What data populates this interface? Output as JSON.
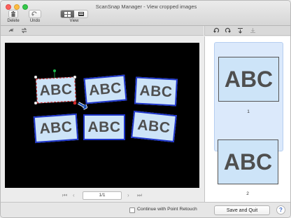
{
  "window": {
    "title": "ScanSnap Manager - View cropped images"
  },
  "toolbar": {
    "delete_label": "Delete",
    "undo_label": "Undo",
    "view_label": "View"
  },
  "canvas": {
    "cards": [
      {
        "text": "ABC"
      },
      {
        "text": "ABC"
      },
      {
        "text": "ABC"
      },
      {
        "text": "ABC"
      },
      {
        "text": "ABC"
      },
      {
        "text": "ABC"
      }
    ]
  },
  "pager": {
    "page": "1/1"
  },
  "thumbnails": [
    {
      "text": "ABC",
      "number": "1"
    },
    {
      "text": "ABC",
      "number": "2"
    }
  ],
  "footer": {
    "checkbox_label": "Continue with Point Retouch",
    "save_label": "Save and Quit",
    "help_label": "?"
  },
  "icons": [
    "trash-icon",
    "undo-icon",
    "view-multi-icon",
    "view-single-icon",
    "rotate-left-icon",
    "rotate-right-icon",
    "flip-icon",
    "save-page-icon",
    "swap-icon",
    "arrow-icon"
  ],
  "colors": {
    "card_border": "#1d34c9",
    "card_fill": "#cde4f8",
    "crop_selection": "#d62a2a",
    "arrow": "#1a4fb2"
  }
}
